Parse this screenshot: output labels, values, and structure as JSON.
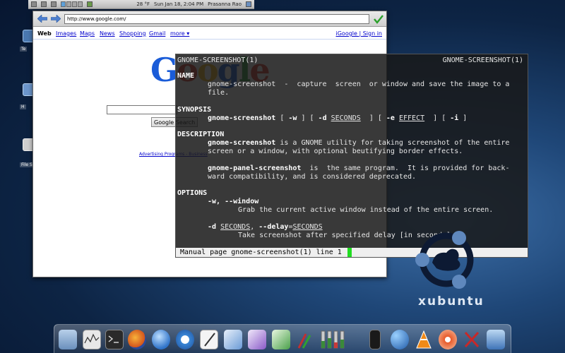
{
  "panel": {
    "temperature": "28 °F",
    "datetime": "Sun Jan 18,  2:04 PM",
    "user": "Prasanna Rao"
  },
  "desktop": {
    "icons": [
      {
        "name": "folder-icon",
        "label": "Te"
      },
      {
        "name": "home-folder-icon",
        "label": "H"
      },
      {
        "name": "file-system-icon",
        "label": "File S"
      }
    ]
  },
  "browser": {
    "url": "http://www.google.com/",
    "links": [
      "Web",
      "Images",
      "Maps",
      "News",
      "Shopping",
      "Gmail",
      "more ▾"
    ],
    "account": "iGoogle | Sign in",
    "logo": "Google",
    "search_button": "Google Search",
    "footer_links": "Advertising Programs - Business"
  },
  "terminal": {
    "header_left": "GNOME-SCREENSHOT(1)",
    "header_right": "GNOME-SCREENSHOT(1)",
    "sections": {
      "name": "NAME",
      "synopsis": "SYNOPSIS",
      "description": "DESCRIPTION",
      "options": "OPTIONS"
    },
    "name_line1": "gnome-screenshot  -  capture  screen  or window and save the image to a",
    "name_line2": "file.",
    "synopsis": {
      "cmd": "gnome-screenshot",
      "p1": " [ ",
      "w": "-w",
      "p2": " ] [ ",
      "d": "-d",
      "p3": " ",
      "seconds": "SECONDS",
      "p4": "  ] [ ",
      "e": "-e",
      "p5": " ",
      "effect": "EFFECT",
      "p6": "  ] [ ",
      "i": "-i",
      "p7": " ]"
    },
    "desc1": {
      "cmd": "gnome-screenshot",
      "rest": " is a GNOME utility for taking screenshot of the entire"
    },
    "desc1_line2": "screen or a window, with optional beutifying border effects.",
    "desc2": {
      "cmd": "gnome-panel-screenshot",
      "rest": "  is  the same program.  It is provided for back-"
    },
    "desc2_line2": "ward compatibility, and is considered deprecated.",
    "opt_window": "-w, --window",
    "opt_window_desc": "Grab the current active window instead of the entire screen.",
    "opt_delay": {
      "flag": "-d",
      "sp": " ",
      "arg": "SECONDS",
      "mid": ", ",
      "long": "--delay",
      "eq": "=",
      "arg2": "SECONDS"
    },
    "opt_delay_desc": "Take screenshot after specified delay [in seconds].",
    "status": "Manual page gnome-screenshot(1) line 1"
  },
  "brand": {
    "text": "xubuntu"
  },
  "dock": {
    "items": [
      "file-manager-icon",
      "system-monitor-icon",
      "terminal-icon",
      "firefox-icon",
      "globe-icon",
      "safari-icon",
      "text-editor-icon",
      "office-writer-icon",
      "office-chart-icon",
      "image-viewer-icon",
      "paint-icon",
      "volume-levels-icon",
      "mobile-phone-icon",
      "comet-icon",
      "vlc-icon",
      "disk-icon",
      "x-app-icon",
      "trash-icon"
    ]
  },
  "colors": {
    "terminal_cursor": "#22dd22",
    "google_blue": "#1a5cd8",
    "google_red": "#d93a2b",
    "google_yellow": "#f3b71b",
    "google_green": "#2d9a3a"
  }
}
